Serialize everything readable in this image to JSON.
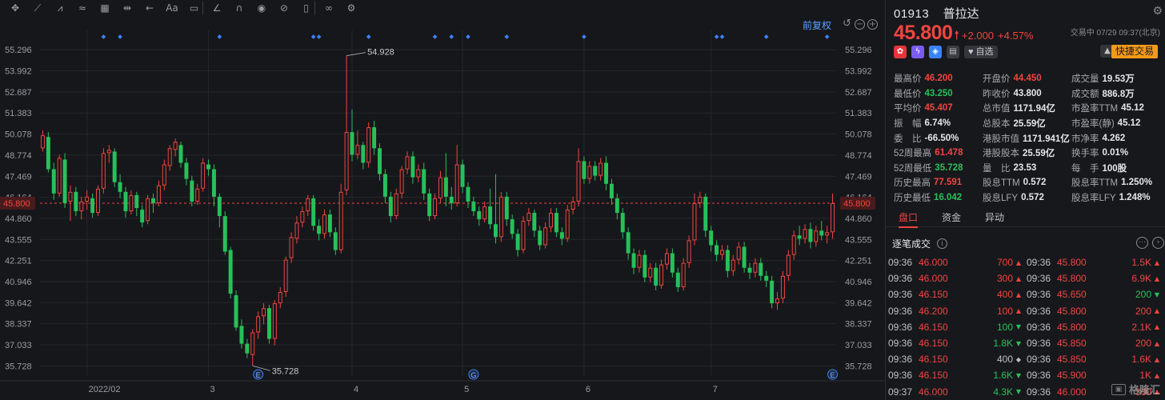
{
  "toolbar": {
    "icons": [
      "crosshair-icon",
      "line-tool-icon",
      "fib-tool-icon",
      "wave-tool-icon",
      "pattern-tool-icon",
      "measure-tool-icon",
      "arrow-tool-icon",
      "text-tool-icon",
      "comment-tool-icon",
      "pencil-tool-icon",
      "magnet-icon",
      "eye-icon",
      "hide-icon",
      "trash-icon",
      "link-icon",
      "gear-icon"
    ],
    "text_tool_label": "Aa"
  },
  "chart_header": {
    "adjust_label": "前复权"
  },
  "chart_data": {
    "type": "candlestick",
    "title": "",
    "ylim": [
      35.1,
      56.0
    ],
    "y_ticks": [
      "55.296",
      "53.992",
      "52.687",
      "51.383",
      "50.078",
      "48.774",
      "47.469",
      "46.164",
      "44.860",
      "43.555",
      "42.251",
      "40.946",
      "39.642",
      "38.337",
      "37.033",
      "35.728"
    ],
    "y_tick_values": [
      55.296,
      53.992,
      52.687,
      51.383,
      50.078,
      48.774,
      47.469,
      46.164,
      44.86,
      43.555,
      42.251,
      40.946,
      39.642,
      38.337,
      37.033,
      35.728
    ],
    "x_labels": [
      "2022/02",
      "3",
      "4",
      "5",
      "6",
      "7"
    ],
    "x_label_bars": [
      8,
      30,
      56,
      76,
      98,
      121
    ],
    "current_price": 45.8,
    "current_price_label": "45.800",
    "annotations": {
      "high": {
        "label": "54.928",
        "value": 54.928,
        "bar": 55
      },
      "low": {
        "label": "35.728",
        "value": 35.728,
        "bar": 38
      }
    },
    "event_markers": [
      {
        "bar": 39,
        "letter": "E"
      },
      {
        "bar": 78,
        "letter": "G"
      },
      {
        "bar": 143,
        "letter": "E"
      }
    ],
    "top_dots": [
      11,
      14,
      32,
      49,
      50,
      59,
      71,
      74,
      77,
      84,
      98,
      122,
      123,
      131,
      142
    ],
    "colors": {
      "up": "#f0453f",
      "down": "#27c05a",
      "grid": "#26272c",
      "current": "#f0453f",
      "marker": "#3b82f6"
    },
    "candles": [
      [
        49.2,
        50.0,
        49.0,
        50.3
      ],
      [
        49.9,
        47.9,
        47.7,
        50.2
      ],
      [
        47.9,
        46.4,
        46.0,
        48.3
      ],
      [
        46.4,
        48.6,
        46.2,
        48.8
      ],
      [
        48.5,
        45.8,
        45.5,
        48.9
      ],
      [
        45.9,
        46.5,
        44.7,
        46.9
      ],
      [
        46.5,
        45.3,
        45.0,
        46.8
      ],
      [
        45.3,
        45.9,
        44.8,
        46.2
      ],
      [
        45.9,
        46.2,
        45.4,
        46.6
      ],
      [
        46.1,
        45.2,
        44.9,
        46.4
      ],
      [
        45.2,
        46.7,
        45.0,
        46.9
      ],
      [
        46.7,
        48.9,
        46.4,
        49.2
      ],
      [
        48.9,
        49.1,
        48.3,
        49.4
      ],
      [
        49.0,
        47.1,
        46.8,
        49.2
      ],
      [
        47.1,
        46.5,
        46.1,
        47.6
      ],
      [
        46.5,
        45.3,
        44.9,
        46.8
      ],
      [
        45.3,
        46.3,
        45.1,
        46.6
      ],
      [
        46.3,
        45.5,
        45.0,
        46.5
      ],
      [
        45.4,
        44.6,
        44.3,
        45.7
      ],
      [
        44.7,
        46.1,
        44.5,
        46.3
      ],
      [
        46.1,
        45.8,
        45.2,
        46.4
      ],
      [
        45.8,
        46.9,
        45.6,
        47.2
      ],
      [
        46.9,
        48.2,
        46.6,
        48.5
      ],
      [
        48.1,
        49.2,
        47.8,
        49.4
      ],
      [
        49.1,
        49.6,
        48.7,
        49.8
      ],
      [
        49.4,
        48.3,
        48.0,
        49.6
      ],
      [
        48.3,
        47.3,
        46.9,
        48.6
      ],
      [
        47.2,
        45.9,
        45.6,
        47.5
      ],
      [
        45.9,
        46.7,
        45.7,
        47.0
      ],
      [
        46.7,
        48.3,
        46.5,
        48.6
      ],
      [
        48.2,
        47.9,
        47.5,
        48.5
      ],
      [
        47.9,
        46.2,
        45.6,
        48.2
      ],
      [
        46.2,
        45.0,
        44.3,
        46.4
      ],
      [
        45.0,
        42.8,
        42.6,
        45.3
      ],
      [
        42.9,
        40.2,
        39.9,
        43.1
      ],
      [
        40.1,
        38.1,
        37.9,
        40.4
      ],
      [
        38.2,
        37.1,
        36.8,
        38.6
      ],
      [
        37.1,
        36.5,
        36.2,
        37.4
      ],
      [
        36.4,
        37.8,
        35.73,
        38.0
      ],
      [
        37.8,
        38.8,
        37.4,
        39.1
      ],
      [
        38.8,
        39.3,
        38.3,
        39.6
      ],
      [
        39.3,
        37.4,
        37.1,
        39.5
      ],
      [
        37.4,
        39.6,
        37.0,
        39.8
      ],
      [
        39.6,
        40.3,
        39.3,
        40.6
      ],
      [
        40.3,
        42.3,
        40.0,
        42.5
      ],
      [
        42.4,
        43.7,
        42.1,
        44.0
      ],
      [
        43.6,
        44.6,
        43.3,
        45.0
      ],
      [
        44.6,
        45.3,
        44.3,
        45.6
      ],
      [
        45.3,
        46.1,
        45.0,
        46.3
      ],
      [
        46.1,
        44.4,
        44.1,
        46.3
      ],
      [
        44.4,
        43.9,
        43.5,
        44.8
      ],
      [
        43.9,
        45.1,
        43.6,
        45.4
      ],
      [
        45.1,
        44.0,
        43.7,
        45.4
      ],
      [
        44.0,
        42.9,
        42.6,
        44.3
      ],
      [
        42.9,
        46.5,
        42.7,
        47.0
      ],
      [
        46.6,
        50.2,
        46.3,
        54.93
      ],
      [
        50.2,
        48.8,
        48.4,
        51.6
      ],
      [
        48.8,
        49.4,
        48.5,
        50.3
      ],
      [
        49.4,
        48.3,
        47.9,
        49.6
      ],
      [
        48.3,
        50.5,
        48.0,
        50.8
      ],
      [
        50.5,
        49.2,
        48.8,
        50.9
      ],
      [
        49.2,
        47.6,
        47.2,
        49.5
      ],
      [
        47.6,
        46.2,
        45.8,
        47.9
      ],
      [
        46.2,
        45.0,
        44.6,
        46.5
      ],
      [
        45.0,
        46.4,
        44.8,
        46.7
      ],
      [
        46.4,
        47.9,
        46.1,
        48.1
      ],
      [
        47.9,
        48.7,
        47.6,
        49.0
      ],
      [
        48.7,
        47.4,
        47.0,
        49.0
      ],
      [
        47.4,
        47.9,
        47.1,
        48.2
      ],
      [
        47.9,
        46.4,
        46.0,
        48.3
      ],
      [
        46.4,
        45.0,
        44.7,
        46.7
      ],
      [
        45.0,
        46.1,
        44.8,
        46.4
      ],
      [
        46.1,
        47.4,
        45.8,
        47.8
      ],
      [
        47.4,
        46.2,
        45.6,
        48.9
      ],
      [
        46.2,
        45.8,
        45.4,
        46.8
      ],
      [
        45.8,
        48.2,
        45.6,
        49.4
      ],
      [
        48.2,
        46.8,
        46.4,
        48.5
      ],
      [
        46.8,
        45.9,
        45.5,
        47.1
      ],
      [
        45.9,
        45.3,
        45.0,
        46.2
      ],
      [
        45.3,
        44.8,
        44.4,
        45.6
      ],
      [
        44.8,
        45.6,
        44.6,
        45.9
      ],
      [
        45.6,
        44.5,
        44.2,
        46.7
      ],
      [
        44.5,
        43.7,
        43.3,
        47.6
      ],
      [
        43.7,
        46.2,
        43.4,
        46.5
      ],
      [
        46.2,
        44.8,
        44.4,
        46.5
      ],
      [
        44.8,
        43.9,
        43.6,
        45.1
      ],
      [
        43.9,
        42.9,
        42.5,
        44.2
      ],
      [
        42.9,
        44.7,
        42.7,
        45.0
      ],
      [
        44.7,
        45.2,
        44.4,
        45.5
      ],
      [
        45.2,
        44.1,
        43.7,
        45.4
      ],
      [
        44.1,
        43.2,
        42.9,
        44.4
      ],
      [
        43.2,
        44.3,
        43.0,
        44.6
      ],
      [
        44.3,
        45.2,
        44.0,
        45.5
      ],
      [
        45.2,
        44.0,
        43.7,
        45.5
      ],
      [
        44.0,
        43.6,
        43.2,
        44.3
      ],
      [
        43.6,
        45.4,
        43.4,
        45.7
      ],
      [
        45.4,
        45.9,
        45.1,
        46.2
      ],
      [
        45.9,
        48.4,
        45.6,
        49.2
      ],
      [
        48.4,
        47.3,
        47.0,
        48.7
      ],
      [
        47.3,
        48.1,
        47.0,
        48.4
      ],
      [
        48.1,
        47.5,
        47.2,
        48.4
      ],
      [
        47.5,
        48.3,
        47.2,
        48.6
      ],
      [
        48.3,
        47.0,
        46.6,
        48.7
      ],
      [
        47.0,
        46.1,
        45.7,
        47.3
      ],
      [
        46.1,
        45.2,
        44.8,
        46.4
      ],
      [
        45.2,
        44.0,
        43.6,
        45.5
      ],
      [
        44.0,
        42.7,
        42.3,
        44.3
      ],
      [
        42.7,
        41.8,
        41.4,
        43.0
      ],
      [
        41.8,
        42.6,
        41.5,
        42.9
      ],
      [
        42.6,
        41.2,
        40.9,
        42.9
      ],
      [
        41.2,
        41.8,
        40.9,
        42.1
      ],
      [
        41.8,
        40.7,
        40.4,
        42.1
      ],
      [
        40.7,
        42.0,
        40.5,
        42.3
      ],
      [
        42.0,
        42.7,
        41.7,
        43.0
      ],
      [
        42.7,
        41.5,
        41.2,
        43.0
      ],
      [
        41.5,
        40.6,
        40.3,
        41.8
      ],
      [
        40.6,
        42.1,
        40.4,
        42.4
      ],
      [
        42.1,
        43.5,
        41.8,
        43.8
      ],
      [
        43.5,
        45.8,
        43.2,
        46.4
      ],
      [
        45.8,
        46.2,
        45.5,
        46.5
      ],
      [
        46.2,
        44.1,
        43.7,
        46.4
      ],
      [
        44.1,
        43.2,
        42.8,
        44.4
      ],
      [
        43.2,
        42.6,
        42.2,
        43.5
      ],
      [
        42.6,
        42.9,
        42.3,
        43.2
      ],
      [
        42.9,
        41.6,
        41.2,
        43.2
      ],
      [
        41.6,
        42.3,
        41.3,
        42.6
      ],
      [
        42.3,
        43.1,
        42.0,
        43.4
      ],
      [
        43.1,
        41.8,
        41.5,
        43.4
      ],
      [
        41.8,
        41.5,
        41.1,
        42.1
      ],
      [
        41.5,
        42.1,
        41.2,
        42.4
      ],
      [
        42.1,
        41.3,
        41.0,
        42.4
      ],
      [
        41.3,
        41.0,
        40.6,
        41.6
      ],
      [
        41.0,
        39.6,
        39.3,
        41.3
      ],
      [
        39.6,
        39.9,
        39.2,
        40.3
      ],
      [
        39.9,
        41.3,
        39.6,
        41.6
      ],
      [
        41.3,
        42.6,
        41.0,
        42.9
      ],
      [
        42.6,
        43.8,
        42.3,
        44.1
      ],
      [
        43.8,
        43.6,
        43.2,
        44.4
      ],
      [
        43.6,
        44.2,
        43.3,
        44.5
      ],
      [
        44.2,
        43.4,
        43.0,
        44.6
      ],
      [
        43.4,
        44.1,
        43.1,
        44.4
      ],
      [
        44.1,
        43.8,
        43.5,
        44.7
      ],
      [
        43.8,
        44.0,
        43.3,
        44.4
      ],
      [
        44.0,
        45.8,
        43.6,
        46.4
      ]
    ]
  },
  "quote": {
    "code": "01913",
    "name": "普拉达",
    "price": "45.800",
    "arrow": "🠕",
    "change": "+2.000",
    "change_pct": "+4.57%",
    "status": "交易中 07/29 09:37(北京)",
    "watch_label": "自选",
    "trade_label": "快捷交易",
    "rows": [
      [
        {
          "label": "最高价",
          "value": "46.200",
          "tone": "up"
        },
        {
          "label": "开盘价",
          "value": "44.450",
          "tone": "up"
        },
        {
          "label": "成交量",
          "value": "19.53万",
          "tone": ""
        }
      ],
      [
        {
          "label": "最低价",
          "value": "43.250",
          "tone": "down"
        },
        {
          "label": "昨收价",
          "value": "43.800",
          "tone": ""
        },
        {
          "label": "成交额",
          "value": "886.8万",
          "tone": ""
        }
      ],
      [
        {
          "label": "平均价",
          "value": "45.407",
          "tone": "up"
        },
        {
          "label": "总市值",
          "value": "1171.94亿",
          "tone": ""
        },
        {
          "label": "市盈率TTM",
          "value": "45.12",
          "tone": ""
        }
      ],
      [
        {
          "label": "振　幅",
          "value": "6.74%",
          "tone": ""
        },
        {
          "label": "总股本",
          "value": "25.59亿",
          "tone": ""
        },
        {
          "label": "市盈率(静)",
          "value": "45.12",
          "tone": ""
        }
      ],
      [
        {
          "label": "委　比",
          "value": "-66.50%",
          "tone": ""
        },
        {
          "label": "港股市值",
          "value": "1171.941亿",
          "tone": ""
        },
        {
          "label": "市净率",
          "value": "4.262",
          "tone": ""
        }
      ],
      [
        {
          "label": "52周最高",
          "value": "61.478",
          "tone": "up"
        },
        {
          "label": "港股股本",
          "value": "25.59亿",
          "tone": ""
        },
        {
          "label": "换手率",
          "value": "0.01%",
          "tone": ""
        }
      ],
      [
        {
          "label": "52周最低",
          "value": "35.728",
          "tone": "down"
        },
        {
          "label": "量　比",
          "value": "23.53",
          "tone": ""
        },
        {
          "label": "每　手",
          "value": "100股",
          "tone": ""
        }
      ],
      [
        {
          "label": "历史最高",
          "value": "77.591",
          "tone": "up"
        },
        {
          "label": "股息TTM",
          "value": "0.572",
          "tone": ""
        },
        {
          "label": "股息率TTM",
          "value": "1.250%",
          "tone": ""
        }
      ],
      [
        {
          "label": "历史最低",
          "value": "16.042",
          "tone": "down"
        },
        {
          "label": "股息LFY",
          "value": "0.572",
          "tone": ""
        },
        {
          "label": "股息率LFY",
          "value": "1.248%",
          "tone": ""
        }
      ]
    ]
  },
  "tabs": [
    {
      "label": "盘口",
      "active": true
    },
    {
      "label": "资金",
      "active": false
    },
    {
      "label": "异动",
      "active": false
    }
  ],
  "ticks": {
    "title": "逐笔成交",
    "rows": [
      [
        {
          "time": "09:36",
          "price": "46.000",
          "vol": "700",
          "dir": "up"
        },
        {
          "time": "09:36",
          "price": "45.800",
          "vol": "1.5K",
          "dir": "up"
        }
      ],
      [
        {
          "time": "09:36",
          "price": "46.000",
          "vol": "300",
          "dir": "up"
        },
        {
          "time": "09:36",
          "price": "45.800",
          "vol": "6.9K",
          "dir": "up"
        }
      ],
      [
        {
          "time": "09:36",
          "price": "46.150",
          "vol": "400",
          "dir": "up"
        },
        {
          "time": "09:36",
          "price": "45.650",
          "vol": "200",
          "dir": "down"
        }
      ],
      [
        {
          "time": "09:36",
          "price": "46.200",
          "vol": "100",
          "dir": "up"
        },
        {
          "time": "09:36",
          "price": "45.800",
          "vol": "200",
          "dir": "up"
        }
      ],
      [
        {
          "time": "09:36",
          "price": "46.150",
          "vol": "100",
          "dir": "down"
        },
        {
          "time": "09:36",
          "price": "45.800",
          "vol": "2.1K",
          "dir": "up"
        }
      ],
      [
        {
          "time": "09:36",
          "price": "46.150",
          "vol": "1.8K",
          "dir": "down"
        },
        {
          "time": "09:36",
          "price": "45.850",
          "vol": "200",
          "dir": "up"
        }
      ],
      [
        {
          "time": "09:36",
          "price": "46.150",
          "vol": "400",
          "dir": "flat"
        },
        {
          "time": "09:36",
          "price": "45.850",
          "vol": "1.6K",
          "dir": "up"
        }
      ],
      [
        {
          "time": "09:36",
          "price": "46.150",
          "vol": "1.6K",
          "dir": "down"
        },
        {
          "time": "09:36",
          "price": "45.900",
          "vol": "1K",
          "dir": "up"
        }
      ],
      [
        {
          "time": "09:37",
          "price": "46.000",
          "vol": "4.3K",
          "dir": "down"
        },
        {
          "time": "09:36",
          "price": "46.000",
          "vol": "300",
          "dir": "up"
        }
      ]
    ]
  },
  "watermark": {
    "text": "格隆汇"
  }
}
